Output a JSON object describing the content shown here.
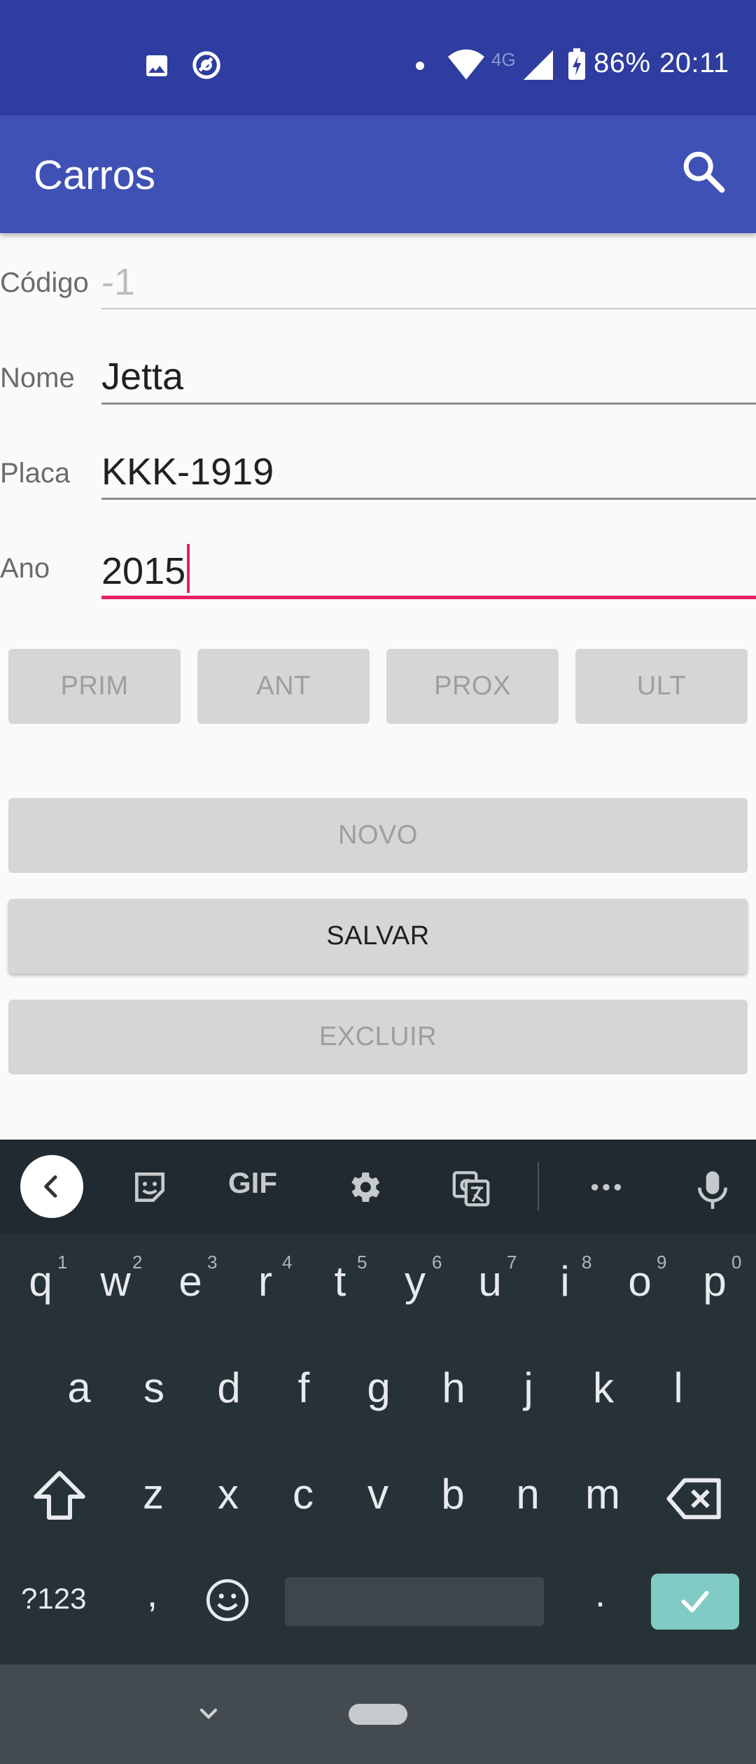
{
  "status_bar": {
    "battery": "86%",
    "time": "20:11",
    "network": "4G"
  },
  "app_bar": {
    "title": "Carros"
  },
  "form": {
    "codigo": {
      "label": "Código",
      "value": "-1"
    },
    "nome": {
      "label": "Nome",
      "value": "Jetta"
    },
    "placa": {
      "label": "Placa",
      "value": "KKK-1919"
    },
    "ano": {
      "label": "Ano",
      "value": "2015"
    }
  },
  "nav_buttons": {
    "prim": "PRIM",
    "ant": "ANT",
    "prox": "PROX",
    "ult": "ULT"
  },
  "actions": {
    "novo": "NOVO",
    "salvar": "SALVAR",
    "excluir": "EXCLUIR"
  },
  "keyboard": {
    "toolbar": {
      "gif": "GIF"
    },
    "row1": [
      "q",
      "w",
      "e",
      "r",
      "t",
      "y",
      "u",
      "i",
      "o",
      "p"
    ],
    "row1_hints": [
      "1",
      "2",
      "3",
      "4",
      "5",
      "6",
      "7",
      "8",
      "9",
      "0"
    ],
    "row2": [
      "a",
      "s",
      "d",
      "f",
      "g",
      "h",
      "j",
      "k",
      "l"
    ],
    "row3": [
      "z",
      "x",
      "c",
      "v",
      "b",
      "n",
      "m"
    ],
    "row4": {
      "symbols": "?123",
      "comma": ",",
      "period": "."
    }
  },
  "colors": {
    "primary": "#3f51b5",
    "primary_dark": "#2e3d9f",
    "accent": "#e91e63",
    "kb_bg": "#263238",
    "enter_key": "#80cbc4"
  }
}
